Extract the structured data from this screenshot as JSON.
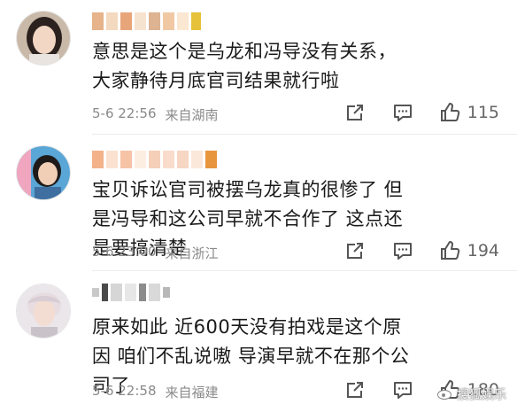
{
  "comments": [
    {
      "text": "意思是这个是乌龙和冯导没有关系，大家静待月底官司结果就行啦",
      "time": "5-6 22:56",
      "location": "来自湖南",
      "likes": "115"
    },
    {
      "text": "宝贝诉讼官司被摆乌龙真的很惨了 但是冯导和这公司早就不合作了 这点还是要搞清楚",
      "time": "5-6 23:00",
      "location": "来自浙江",
      "likes": "194"
    },
    {
      "text": "原来如此 近600天没有拍戏是这个原因 咱们不乱说嗷 导演早就不在那个公司了",
      "time": "5-6 22:58",
      "location": "来自福建",
      "likes": "180"
    }
  ],
  "watermark": "搜狐娱乐",
  "colors": {
    "text": "#1a1a1a",
    "meta": "#8a8a8a",
    "icon": "#555555",
    "divider": "#ececec"
  }
}
